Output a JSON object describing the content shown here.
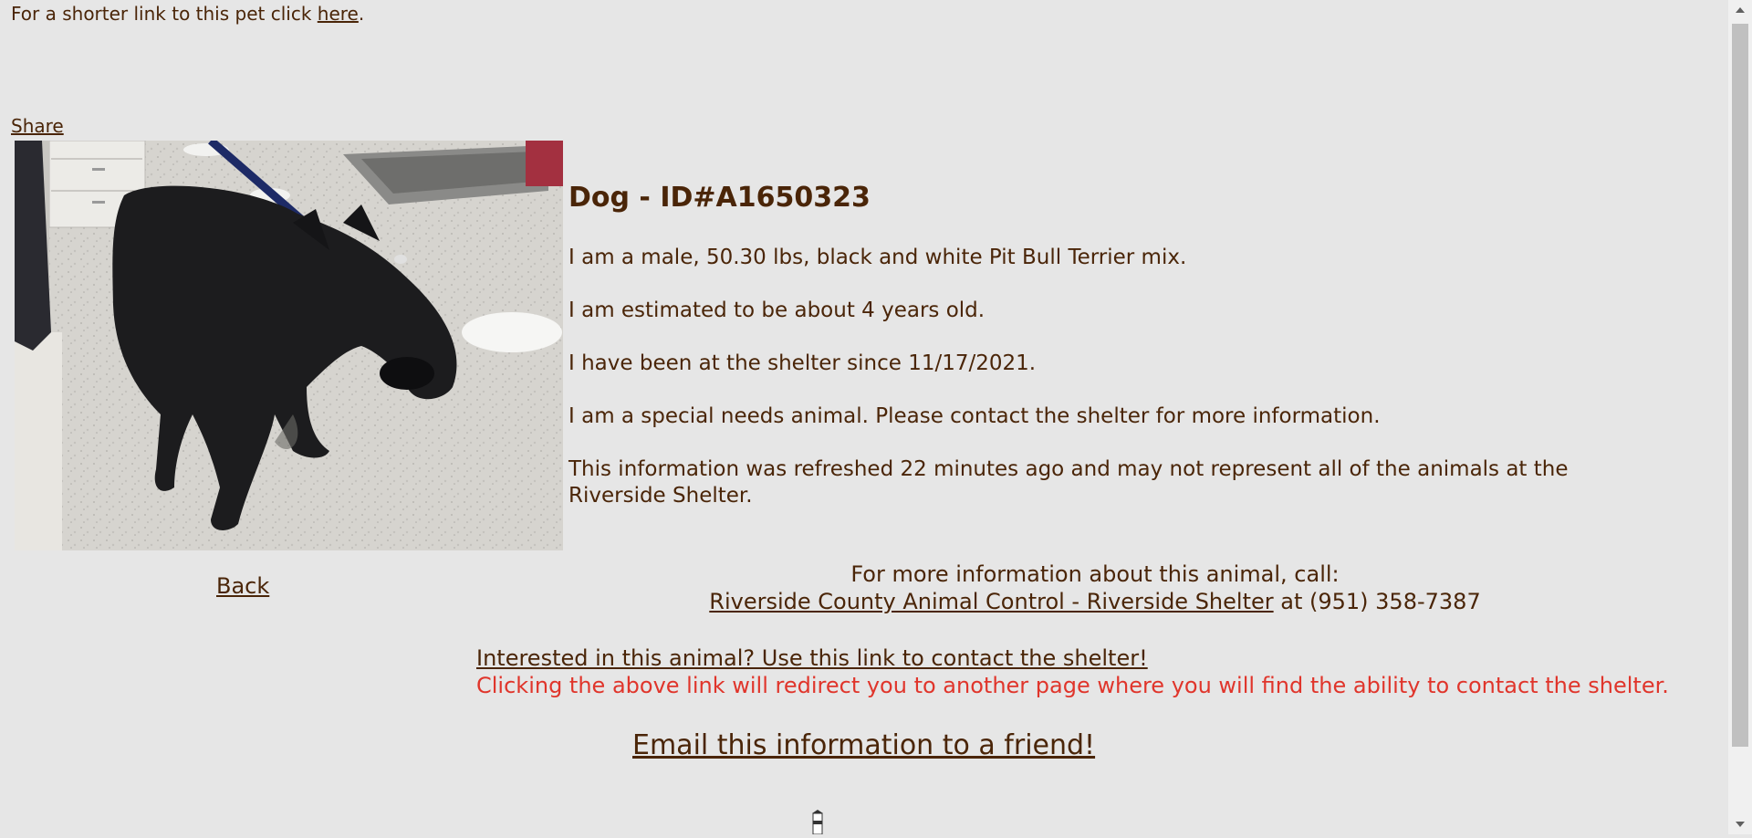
{
  "top_line": {
    "prefix": "For a shorter link to this pet click ",
    "link_label": "here",
    "suffix": "."
  },
  "share_label": "Share",
  "pet": {
    "photo_icon": "dog-photo",
    "title": "Dog - ID#A1650323",
    "description": [
      "I am a male, 50.30 lbs, black and white Pit Bull Terrier mix.",
      "I am estimated to be about 4 years old.",
      "I have been at the shelter since 11/17/2021.",
      "I am a special needs animal. Please contact the shelter for more information.",
      "This information was refreshed 22 minutes ago and may not represent all of the animals at the Riverside Shelter."
    ]
  },
  "back_label": "Back",
  "call": {
    "heading": "For more information about this animal, call:",
    "shelter_link": "Riverside County Animal Control - Riverside Shelter",
    "phone_text": " at (951) 358-7387"
  },
  "contact": {
    "link_label": "Interested in this animal? Use this link to contact the shelter!",
    "note": "Clicking the above link will redirect you to another page where you will find the ability to contact the shelter."
  },
  "email_label": "Email this information to a friend!",
  "colors": {
    "background": "#e6e6e6",
    "text": "#4a2508",
    "warning": "#e0352b"
  }
}
